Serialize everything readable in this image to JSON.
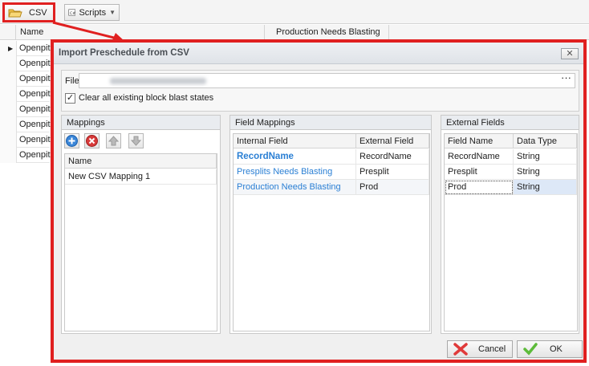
{
  "toolbar": {
    "csv_label": "CSV",
    "scripts_label": "Scripts"
  },
  "grid": {
    "col_name": "Name",
    "col_production": "Production Needs Blasting",
    "rows": [
      "Openpit",
      "Openpit",
      "Openpit",
      "Openpit",
      "Openpit",
      "Openpit",
      "Openpit",
      "Openpit"
    ]
  },
  "dialog": {
    "title": "Import Preschedule from CSV",
    "close_glyph": "✕",
    "file_label": "File",
    "file_browse": "···",
    "clear_label": "Clear all existing block blast states",
    "clear_checked": "✓",
    "mappings": {
      "title": "Mappings",
      "col_name": "Name",
      "items": [
        "New CSV Mapping 1"
      ]
    },
    "field_mappings": {
      "title": "Field Mappings",
      "col_internal": "Internal Field",
      "col_external": "External Field",
      "rows": [
        {
          "internal": "RecordName",
          "external": "RecordName"
        },
        {
          "internal": "Presplits Needs Blasting",
          "external": "Presplit"
        },
        {
          "internal": "Production Needs Blasting",
          "external": "Prod"
        }
      ]
    },
    "external_fields": {
      "title": "External Fields",
      "col_name": "Field Name",
      "col_type": "Data Type",
      "rows": [
        {
          "name": "RecordName",
          "type": "String"
        },
        {
          "name": "Presplit",
          "type": "String"
        },
        {
          "name": "Prod",
          "type": "String"
        }
      ]
    },
    "cancel_label": "Cancel",
    "ok_label": "OK"
  },
  "colors": {
    "highlight": "#e02020",
    "link": "#2a7fd4",
    "selected_row": "#dde8f7"
  }
}
